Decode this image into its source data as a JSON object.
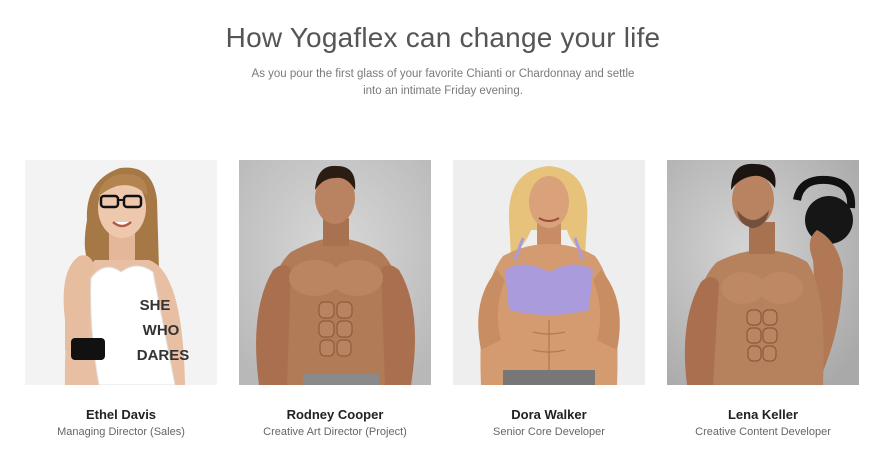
{
  "section": {
    "title": "How Yogaflex can change your life",
    "subtitle": "As you pour the first glass of your favorite Chianti or Chardonnay and settle into an intimate Friday evening."
  },
  "team": [
    {
      "name": "Ethel Davis",
      "role": "Managing Director (Sales)",
      "shirt_text": [
        "SHE",
        "WHO",
        "DARES"
      ],
      "photo_bg": "#f2f2f2",
      "skin": "#e9c2a6",
      "hair": "#a57845",
      "top": "#ffffff"
    },
    {
      "name": "Rodney Cooper",
      "role": "Creative Art Director (Project)",
      "photo_bg": "#cfcfcf",
      "skin": "#b07a58",
      "hair": "#2a1d14"
    },
    {
      "name": "Dora Walker",
      "role": "Senior Core Developer",
      "photo_bg": "#ececec",
      "skin": "#d3996e",
      "hair": "#e6c27a",
      "top": "#a99bdc"
    },
    {
      "name": "Lena Keller",
      "role": "Creative Content Developer",
      "photo_bg": "#c9c9c9",
      "skin": "#b6815d",
      "hair": "#1b1410"
    }
  ]
}
